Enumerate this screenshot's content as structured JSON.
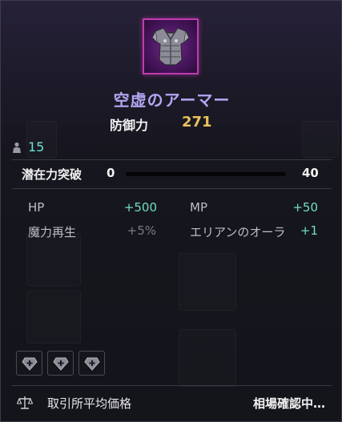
{
  "item": {
    "name": "空虚のアーマー",
    "rarity_color": "#c13bb0",
    "icon": "armor-icon"
  },
  "main_stat": {
    "label": "防御力",
    "value": "271"
  },
  "requirement": {
    "icon": "person-icon",
    "value": "15"
  },
  "potential": {
    "label": "潜在力突破",
    "min": "0",
    "max": "40",
    "progress": 0.0
  },
  "options": [
    {
      "label": "HP",
      "value": "+500"
    },
    {
      "label": "MP",
      "value": "+50"
    },
    {
      "label": "魔力再生",
      "value": "+5%"
    },
    {
      "label": "エリアンのオーラ",
      "value": "+1"
    }
  ],
  "sockets": [
    {
      "icon": "gem-plus-icon"
    },
    {
      "icon": "gem-plus-icon"
    },
    {
      "icon": "gem-plus-icon"
    }
  ],
  "footer": {
    "icon": "scales-icon",
    "label": "取引所平均価格",
    "status": "相場確認中…"
  }
}
